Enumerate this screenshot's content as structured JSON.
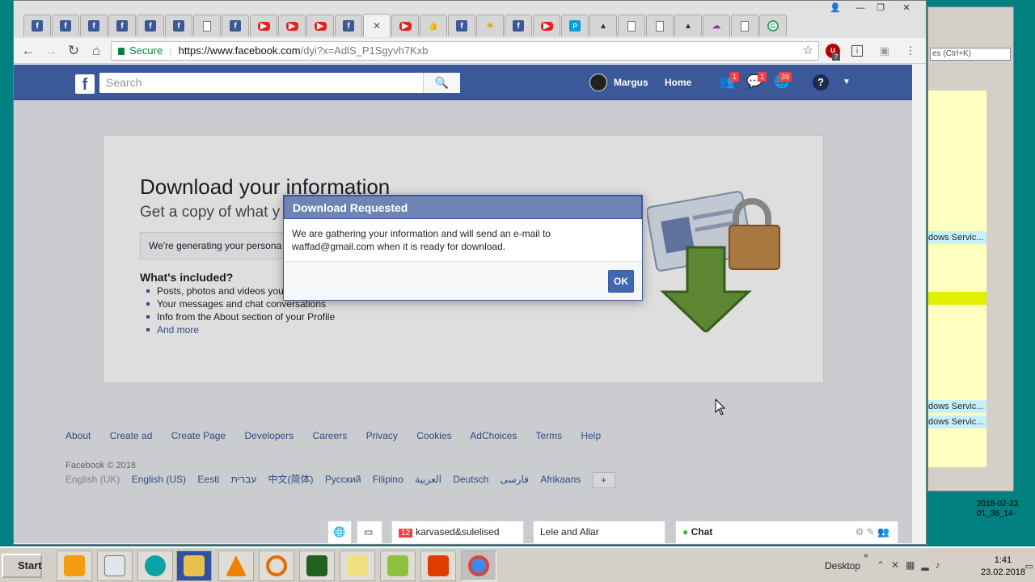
{
  "browser": {
    "tabs": [
      {
        "icon": "fb"
      },
      {
        "icon": "fb"
      },
      {
        "icon": "fb"
      },
      {
        "icon": "fb"
      },
      {
        "icon": "fb"
      },
      {
        "icon": "fb"
      },
      {
        "icon": "doc"
      },
      {
        "icon": "fb"
      },
      {
        "icon": "yt"
      },
      {
        "icon": "yt"
      },
      {
        "icon": "yt"
      },
      {
        "icon": "fb"
      },
      {
        "icon": "close",
        "active": true
      },
      {
        "icon": "yt"
      },
      {
        "icon": "like"
      },
      {
        "icon": "fb"
      },
      {
        "icon": "sun"
      },
      {
        "icon": "fb"
      },
      {
        "icon": "yt"
      },
      {
        "icon": "pm"
      },
      {
        "icon": "pic"
      },
      {
        "icon": "doc"
      },
      {
        "icon": "doc"
      },
      {
        "icon": "pic"
      },
      {
        "icon": "cloud"
      },
      {
        "icon": "doc"
      },
      {
        "icon": "g"
      }
    ],
    "secure_label": "Secure",
    "url_host": "https://www.facebook.com",
    "url_path": "/dyi?x=AdlS_P1Sgyvh7Kxb",
    "ext_badge": "7"
  },
  "facebook": {
    "search_placeholder": "Search",
    "user_name": "Margus",
    "home_label": "Home",
    "friend_badge": "1",
    "message_badge": "1",
    "notif_badge": "39",
    "page_title": "Download your information",
    "page_subtitle": "Get a copy of what y",
    "generating_text": "We're generating your persona",
    "included_title": "What's included?",
    "included_items": [
      "Posts, photos and videos you",
      "Your messages and chat conversations",
      "Info from the About section of your Profile",
      "And more"
    ],
    "footer_links": [
      "About",
      "Create ad",
      "Create Page",
      "Developers",
      "Careers",
      "Privacy",
      "Cookies",
      "AdChoices",
      "Terms",
      "Help"
    ],
    "copyright": "Facebook © 2018",
    "languages": [
      "English (UK)",
      "English (US)",
      "Eesti",
      "עברית",
      "中文(简体)",
      "Русский",
      "Filipino",
      "العربية",
      "Deutsch",
      "فارسی",
      "Afrikaans"
    ],
    "chat_groups": [
      {
        "badge": "12",
        "name": "karvased&sulelised"
      },
      {
        "name": "Lele and Allar"
      }
    ],
    "chat_label": "Chat"
  },
  "dialog": {
    "title": "Download Requested",
    "body_line1": "We are gathering your information and will send an e-mail to",
    "body_line2": "waffad@gmail.com when it is ready for download.",
    "ok_label": "OK"
  },
  "right_app": {
    "search_hint": "es (Ctrl+K)",
    "rows": [
      "dows Servic...",
      "dows Servic...",
      "dows Servic..."
    ],
    "dates": [
      "2018-02-23",
      "01_38_14-"
    ]
  },
  "taskbar": {
    "start_label": "Start",
    "desktop_label": "Desktop",
    "time": "1:41",
    "date": "23.02.2018"
  },
  "colors": {
    "facebook_blue": "#3b5998",
    "dialog_header": "#6d84b4",
    "ok_button": "#4267b2"
  }
}
